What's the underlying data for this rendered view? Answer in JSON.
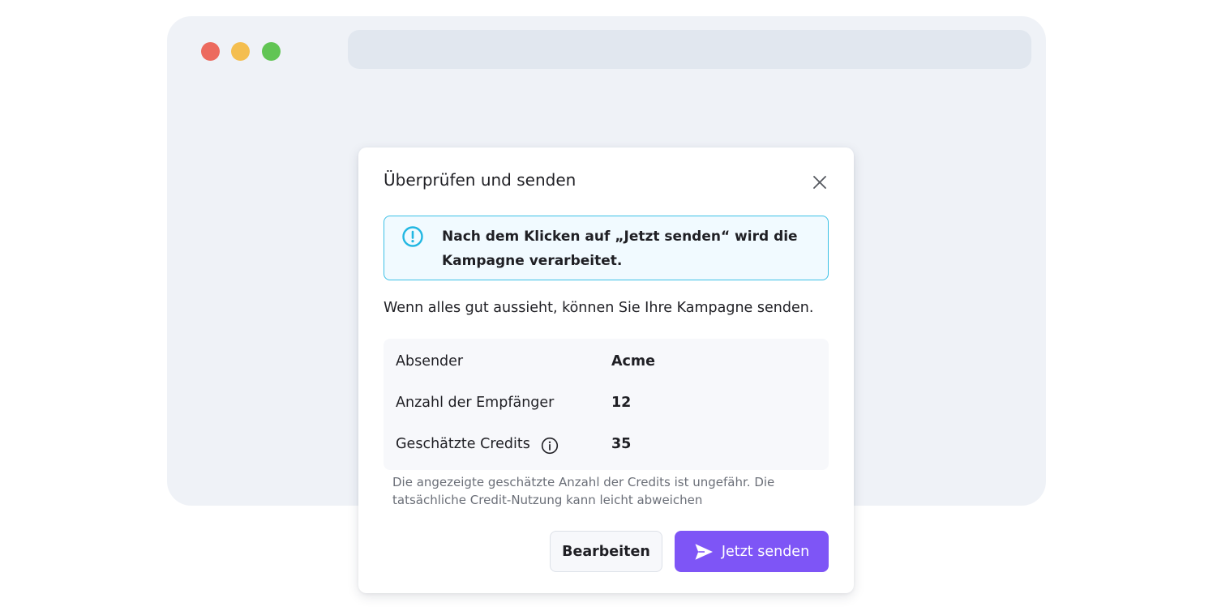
{
  "colors": {
    "traffic_red": "#ec6a5e",
    "traffic_yellow": "#f4be4f",
    "traffic_green": "#61c554",
    "accent": "#7e55f6",
    "info": "#22b7e2"
  },
  "dialog": {
    "title": "Überprüfen und senden",
    "close_icon": "close-icon",
    "notice": {
      "icon": "alert-circle-icon",
      "text": "Nach dem Klicken auf „Jetzt senden“ wird die Kampagne verarbeitet."
    },
    "intro": "Wenn alles gut aussieht, können Sie Ihre Kampagne senden.",
    "summary": [
      {
        "label": "Absender",
        "value": "Acme"
      },
      {
        "label": "Anzahl der Empfänger",
        "value": "12"
      },
      {
        "label": "Geschätzte Credits",
        "value": "35",
        "icon": "info-icon"
      }
    ],
    "footnote": "Die angezeigte geschätzte Anzahl der Credits ist ungefähr. Die tatsächliche Credit-Nutzung kann leicht abweichen",
    "buttons": {
      "edit_label": "Bearbeiten",
      "send_label": "Jetzt senden",
      "send_icon": "send-icon"
    }
  }
}
